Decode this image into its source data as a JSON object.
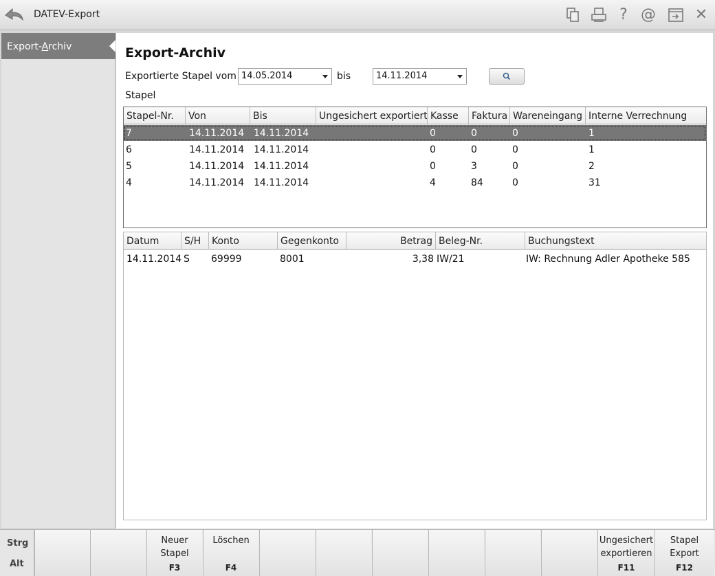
{
  "window": {
    "title": "DATEV-Export",
    "toolbar_icons": [
      "copy-icon",
      "print-icon",
      "help-icon",
      "email-icon",
      "window-icon",
      "close-icon"
    ],
    "help_glyph": "?",
    "email_glyph": "@",
    "close_glyph": "✕"
  },
  "sidebar": {
    "items": [
      {
        "label_before": "Export-",
        "label_access": "A",
        "label_after": "rchiv"
      }
    ]
  },
  "main": {
    "title": "Export-Archiv",
    "filter": {
      "label": "Exportierte Stapel vom",
      "from_value": "14.05.2014",
      "to_label": "bis",
      "to_value": "14.11.2014"
    },
    "stapel_label": "Stapel",
    "stapel_table": {
      "columns": [
        "Stapel-Nr.",
        "Von",
        "Bis",
        "Ungesichert exportiert",
        "Kasse",
        "Faktura",
        "Wareneingang",
        "Interne Verrechnung"
      ],
      "rows": [
        [
          "7",
          "14.11.2014",
          "14.11.2014",
          "",
          "0",
          "0",
          "0",
          "1"
        ],
        [
          "6",
          "14.11.2014",
          "14.11.2014",
          "",
          "0",
          "0",
          "0",
          "1"
        ],
        [
          "5",
          "14.11.2014",
          "14.11.2014",
          "",
          "0",
          "3",
          "0",
          "2"
        ],
        [
          "4",
          "14.11.2014",
          "14.11.2014",
          "",
          "4",
          "84",
          "0",
          "31"
        ]
      ],
      "selected_row": 0
    },
    "buchung_table": {
      "columns": [
        "Datum",
        "S/H",
        "Konto",
        "Gegenkonto",
        "Betrag",
        "Beleg-Nr.",
        "Buchungstext"
      ],
      "rows": [
        [
          "14.11.2014",
          "S",
          "69999",
          "8001",
          "3,38",
          "IW/21",
          "IW: Rechnung Adler Apotheke 585"
        ]
      ]
    }
  },
  "fkeys": {
    "modifier_strg": "Strg",
    "modifier_alt": "Alt",
    "keys": [
      {
        "label": "",
        "key": ""
      },
      {
        "label": "",
        "key": ""
      },
      {
        "label": "Neuer\nStapel",
        "key": "F3"
      },
      {
        "label": "Löschen",
        "key": "F4"
      },
      {
        "label": "",
        "key": ""
      },
      {
        "label": "",
        "key": ""
      },
      {
        "label": "",
        "key": ""
      },
      {
        "label": "",
        "key": ""
      },
      {
        "label": "",
        "key": ""
      },
      {
        "label": "",
        "key": ""
      },
      {
        "label": "Ungesichert\nexportieren",
        "key": "F11"
      },
      {
        "label": "Stapel\nExport",
        "key": "F12"
      }
    ]
  },
  "colors": {
    "selection": "#777777",
    "nav_active": "#7d7d7d"
  }
}
